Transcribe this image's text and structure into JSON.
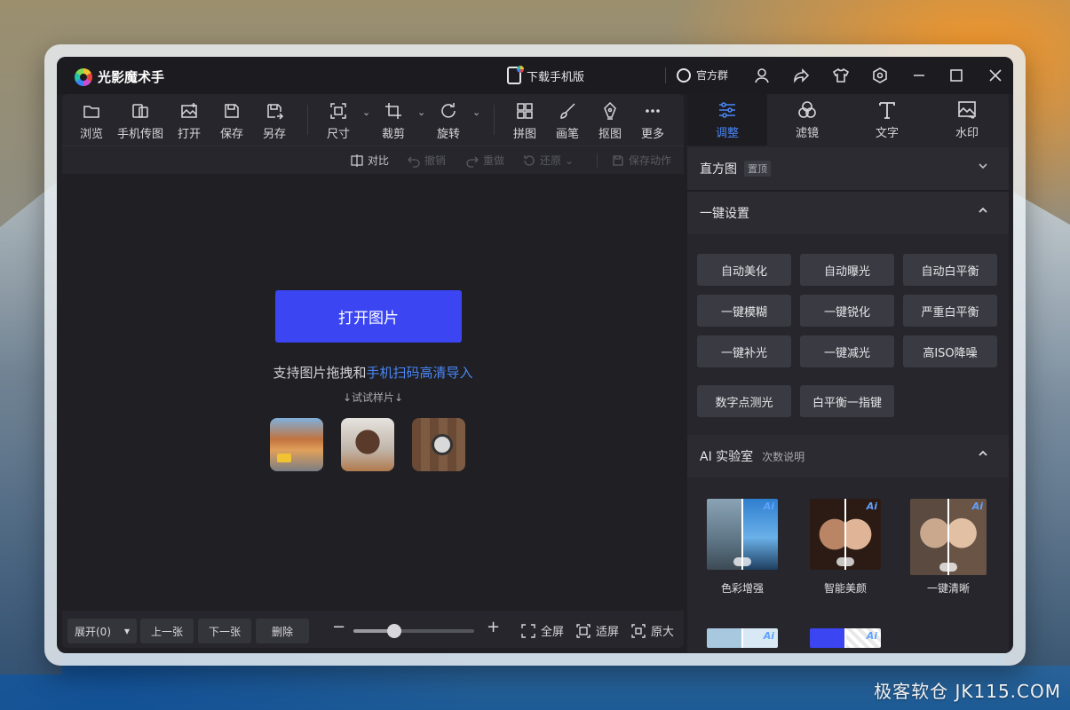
{
  "app": {
    "name": "光影魔术手",
    "download_phone": "下载手机版",
    "group_chat": "官方群"
  },
  "toolbar": {
    "items": [
      {
        "label": "浏览",
        "icon": "folder-icon"
      },
      {
        "label": "手机传图",
        "icon": "phone-transfer-icon"
      },
      {
        "label": "打开",
        "icon": "open-image-icon"
      },
      {
        "label": "保存",
        "icon": "save-icon"
      },
      {
        "label": "另存",
        "icon": "save-as-icon"
      },
      {
        "label": "尺寸",
        "icon": "resize-icon"
      },
      {
        "label": "裁剪",
        "icon": "crop-icon"
      },
      {
        "label": "旋转",
        "icon": "rotate-icon"
      },
      {
        "label": "拼图",
        "icon": "collage-icon"
      },
      {
        "label": "画笔",
        "icon": "brush-icon"
      },
      {
        "label": "抠图",
        "icon": "cutout-icon"
      },
      {
        "label": "更多",
        "icon": "more-icon"
      }
    ]
  },
  "subbar": {
    "compare": "对比",
    "undo": "撤销",
    "redo": "重做",
    "restore": "还原",
    "save_action": "保存动作"
  },
  "canvas": {
    "open_button": "打开图片",
    "support_prefix": "支持图片拖拽和",
    "support_link": "手机扫码高清导入",
    "try_sample": "↓试试样片↓"
  },
  "bottombar": {
    "expand": "展开(0)",
    "prev": "上一张",
    "next": "下一张",
    "delete": "删除",
    "zoom_fraction": 0.34,
    "fullscreen": "全屏",
    "fit": "适屏",
    "original": "原大"
  },
  "right_tabs": [
    {
      "label": "调整",
      "icon": "sliders-icon",
      "active": true
    },
    {
      "label": "滤镜",
      "icon": "filter-icon",
      "active": false
    },
    {
      "label": "文字",
      "icon": "text-icon",
      "active": false
    },
    {
      "label": "水印",
      "icon": "watermark-icon",
      "active": false
    }
  ],
  "panel": {
    "histogram": {
      "title": "直方图",
      "badge": "置顶"
    },
    "one_click": {
      "title": "一键设置",
      "presets": [
        "自动美化",
        "自动曝光",
        "自动白平衡",
        "一键模糊",
        "一键锐化",
        "严重白平衡",
        "一键补光",
        "一键减光",
        "高ISO降噪",
        "数字点测光",
        "白平衡一指键"
      ]
    },
    "ai_lab": {
      "title": "AI 实验室",
      "sub": "次数说明",
      "cards": [
        {
          "label": "色彩增强"
        },
        {
          "label": "智能美颜"
        },
        {
          "label": "一键清晰"
        }
      ],
      "badge": "Ai"
    }
  },
  "watermark": "极客软仓 JK115.COM",
  "colors": {
    "accent": "#3b45f2",
    "link": "#4a86f5",
    "window_bg": "#1f1f24"
  }
}
